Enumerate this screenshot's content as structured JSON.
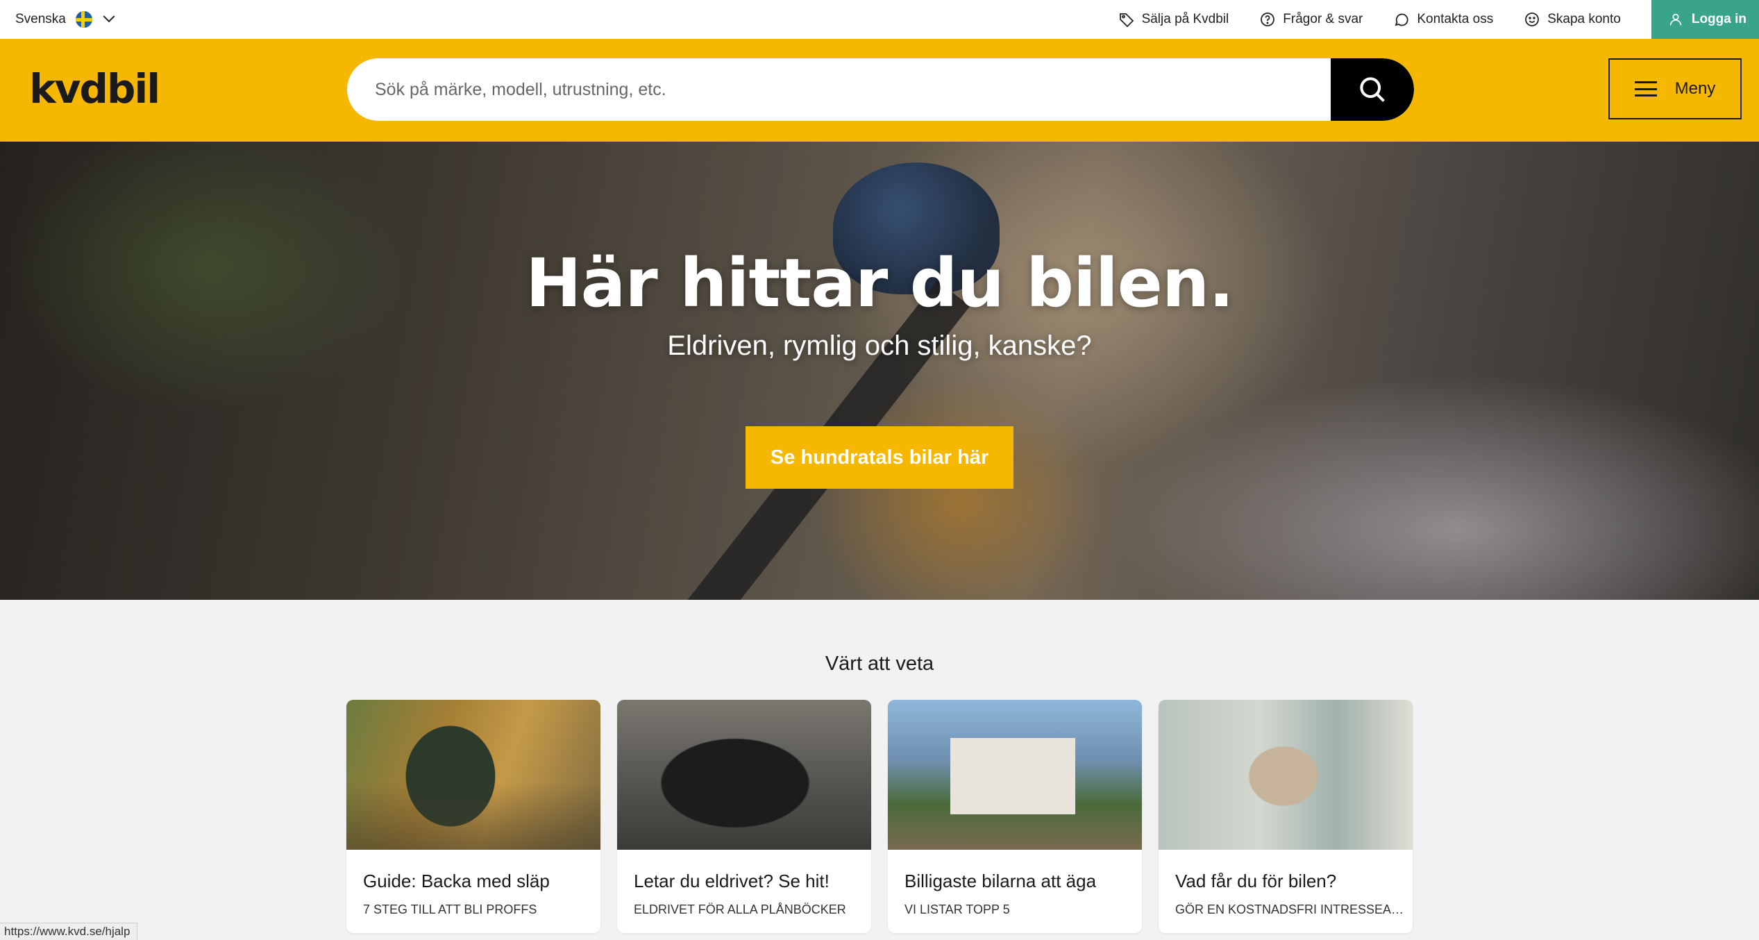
{
  "topbar": {
    "language": "Svenska",
    "links": [
      {
        "label": "Sälja på Kvdbil",
        "icon": "tag-icon"
      },
      {
        "label": "Frågor & svar",
        "icon": "question-icon"
      },
      {
        "label": "Kontakta oss",
        "icon": "chat-icon"
      },
      {
        "label": "Skapa konto",
        "icon": "smiley-icon"
      }
    ],
    "login_label": "Logga in"
  },
  "header": {
    "logo": "kvdbil",
    "search_placeholder": "Sök på märke, modell, utrustning, etc.",
    "menu_label": "Meny"
  },
  "hero": {
    "title": "Här hittar du bilen.",
    "subtitle": "Eldriven, rymlig och stilig, kanske?",
    "cta": "Se hundratals bilar här"
  },
  "section": {
    "title": "Värt att veta",
    "cards": [
      {
        "title": "Guide: Backa med släp",
        "subtitle": "7 STEG TILL ATT BLI PROFFS"
      },
      {
        "title": "Letar du eldrivet? Se hit!",
        "subtitle": "ELDRIVET FÖR ALLA PLÅNBÖCKER"
      },
      {
        "title": "Billigaste bilarna att äga",
        "subtitle": "VI LISTAR TOPP 5"
      },
      {
        "title": "Vad får du för bilen?",
        "subtitle": "GÖR EN KOSTNADSFRI INTRESSEANMÄLAN"
      }
    ]
  },
  "status_url": "https://www.kvd.se/hjalp",
  "colors": {
    "brand_yellow": "#f5b700",
    "login_green": "#3aa48b",
    "search_button": "#000000"
  }
}
